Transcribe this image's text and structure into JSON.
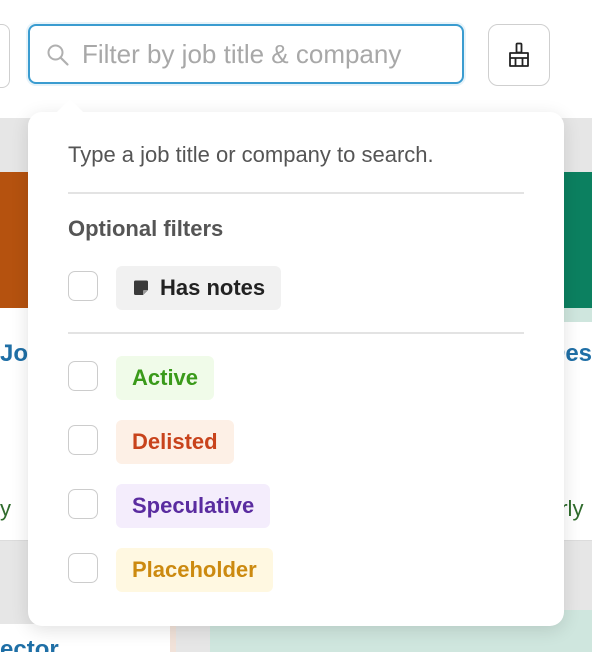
{
  "search": {
    "placeholder": "Filter by job title & company",
    "value": ""
  },
  "popover": {
    "hint": "Type a job title or company to search.",
    "optional_filters_title": "Optional filters",
    "has_notes_label": "Has notes",
    "status_filters": [
      {
        "label": "Active",
        "text_color": "#3a9a1a",
        "bg_color": "#f0fbe9"
      },
      {
        "label": "Delisted",
        "text_color": "#c8431c",
        "bg_color": "#fdf0e6"
      },
      {
        "label": "Speculative",
        "text_color": "#5a2ca0",
        "bg_color": "#f4edfc"
      },
      {
        "label": "Placeholder",
        "text_color": "#cc8a10",
        "bg_color": "#fff8e1"
      }
    ]
  },
  "background": {
    "left_card_title": "Jo",
    "left_card_sub": "y",
    "right_card_title": "Des",
    "right_card_sub": "arly",
    "lower_left_title": "ector"
  },
  "colors": {
    "focus_ring": "#3a9cd0",
    "link_blue": "#1f6fa6",
    "band_orange": "#b5520f",
    "band_green": "#0c8060"
  },
  "icons": {
    "search": "search-icon",
    "clean": "broom-icon",
    "note": "note-icon"
  }
}
